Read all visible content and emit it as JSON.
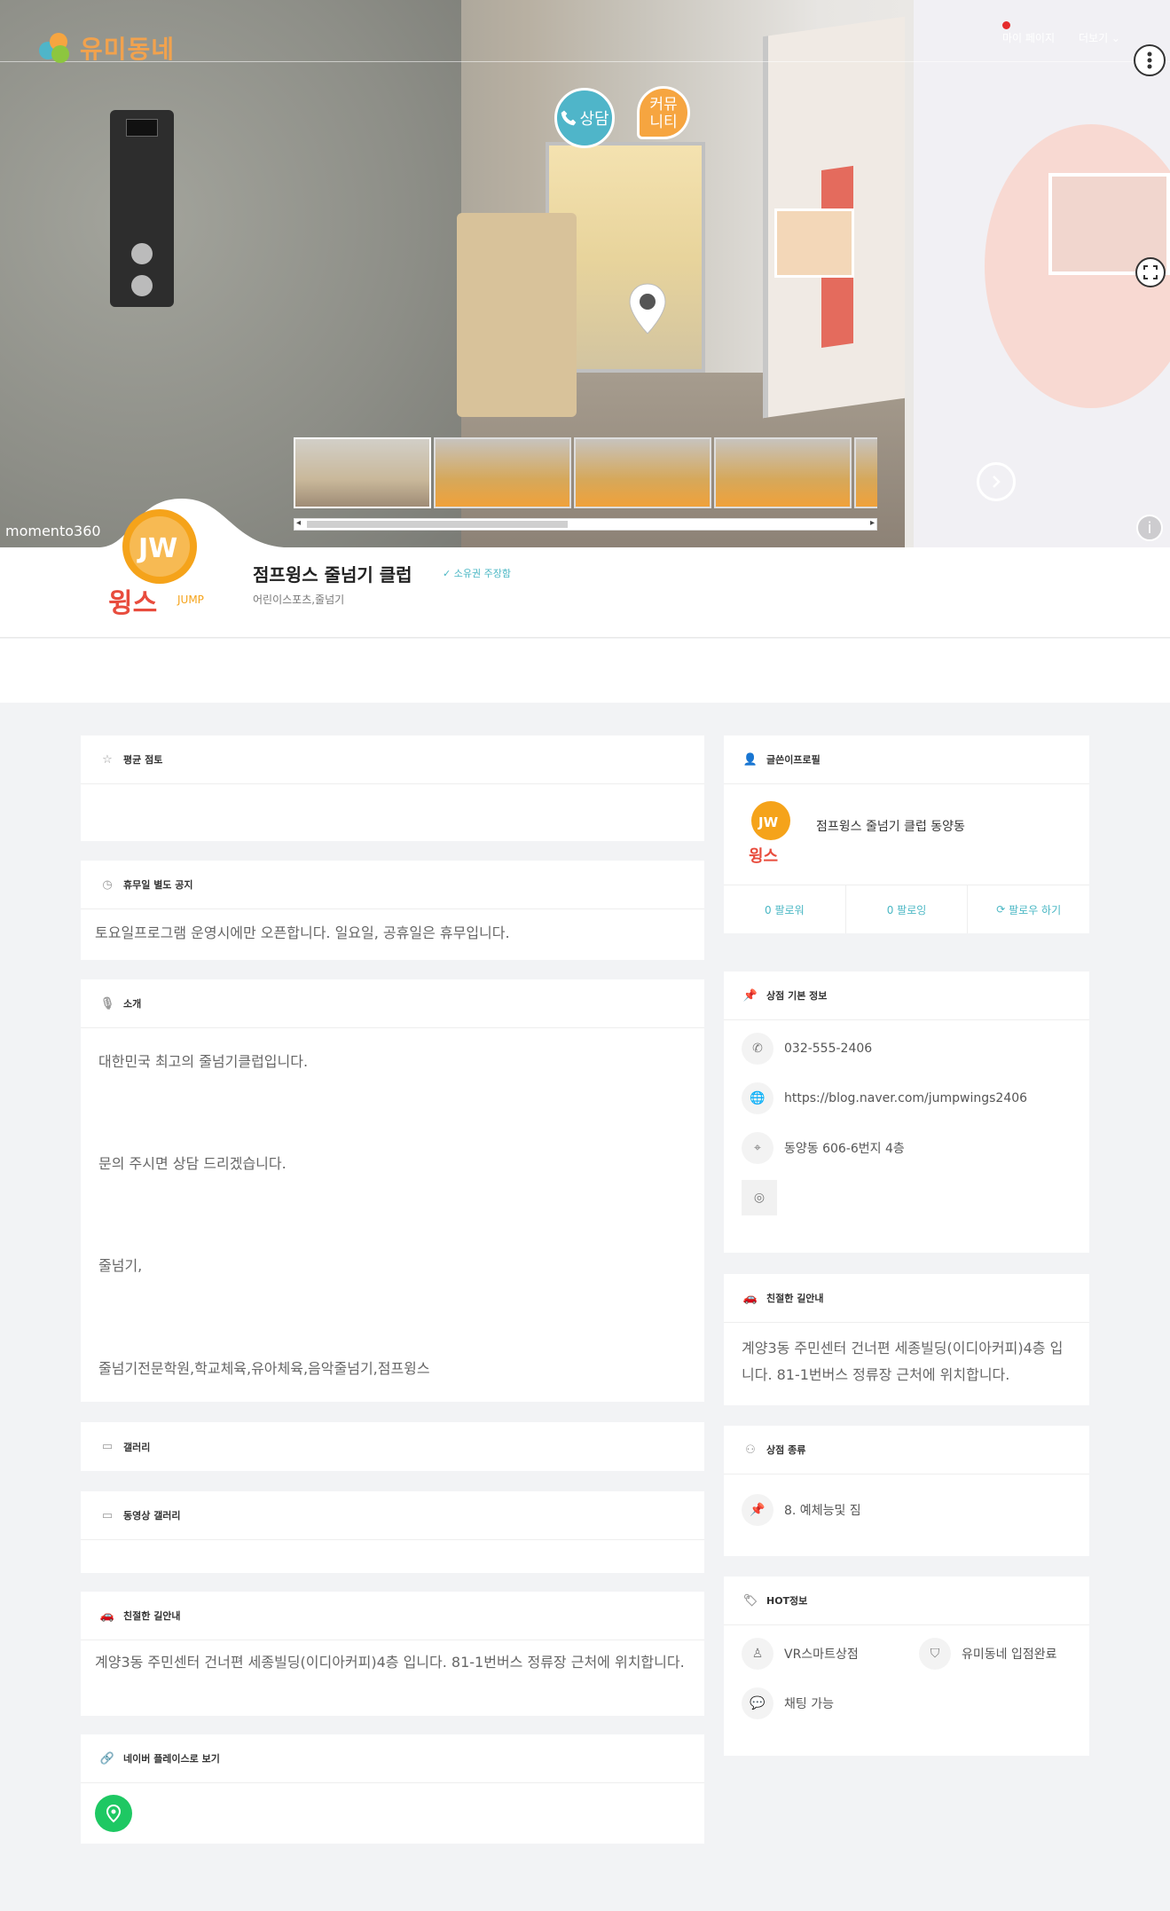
{
  "header": {
    "brand_name": "유미동네",
    "my_page": "마이 페이지",
    "more": "더보기 ⌄",
    "watermark": "momento360"
  },
  "hero": {
    "call_bubble": "상담",
    "community_bubble_line1": "커뮤",
    "community_bubble_line2": "니티"
  },
  "shop": {
    "name": "점프윙스 줄넘기 클럽",
    "owner_claim": "소유권 주장함",
    "category": "어린이스포츠,줄넘기",
    "logo_alt_text": "JW 윙스 JUMP"
  },
  "left": {
    "rating": {
      "title": "평균 점토"
    },
    "holiday": {
      "title": "휴무일 별도 공지",
      "text": "토요일프로그램 운영시에만 오픈합니다. 일요일, 공휴일은 휴무입니다."
    },
    "intro": {
      "title": "소개",
      "lines": [
        "대한민국 최고의 줄넘기클럽입니다.",
        "문의 주시면 상담 드리겠습니다.",
        "줄넘기,",
        "줄넘기전문학원,학교체육,유아체육,음악줄넘기,점프윙스"
      ]
    },
    "gallery": {
      "title": "갤러리"
    },
    "video_gallery": {
      "title": "동영상 갤러리"
    },
    "directions": {
      "title": "친절한 길안내",
      "text": "계양3동 주민센터 건너편 세종빌딩(이디아커피)4층 입니다. 81-1번버스 정류장 근처에 위치합니다."
    },
    "naver": {
      "title": "네이버 플레이스로 보기"
    }
  },
  "right": {
    "profile": {
      "title": "글쓴이프로필",
      "name": "점프윙스 줄넘기 클럽 동양동",
      "followers": "0 팔로워",
      "following": "0 팔로잉",
      "follow_btn": "팔로우 하기"
    },
    "basic_info": {
      "title": "상점 기본 정보",
      "phone": "032-555-2406",
      "website": "https://blog.naver.com/jumpwings2406",
      "address": "동양동 606-6번지 4층"
    },
    "directions": {
      "title": "친절한 길안내",
      "text": "계양3동 주민센터 건너편 세종빌딩(이디아커피)4층 입니다. 81-1번버스 정류장 근처에 위치합니다."
    },
    "shop_type": {
      "title": "상점 종류",
      "value": "8. 예체능및 짐"
    },
    "hot": {
      "title": "HOT정보",
      "vr": "VR스마트상점",
      "joined": "유미동네 입점완료",
      "chat": "채팅 가능"
    }
  }
}
